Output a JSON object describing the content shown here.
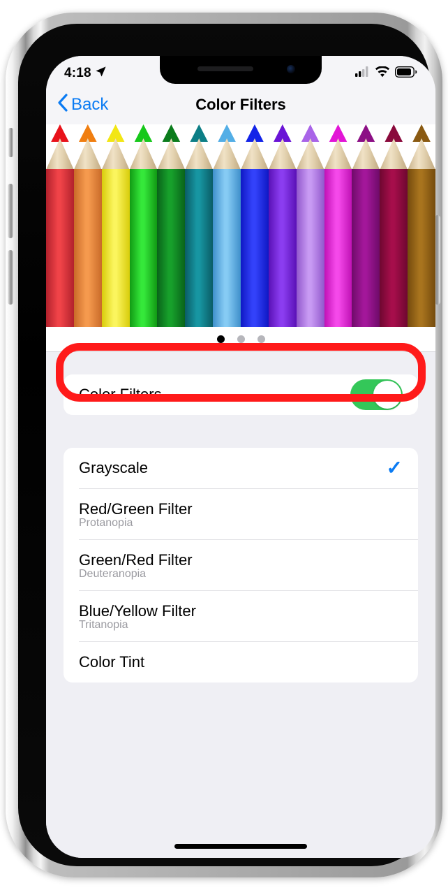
{
  "device": {
    "name": "iphone-x",
    "frame_color": "#c9c9c9"
  },
  "status_bar": {
    "time": "4:18",
    "location_icon": "location-arrow-icon",
    "cellular_icon": "cellular-signal-icon",
    "cellular_bars": 2,
    "wifi_icon": "wifi-icon",
    "battery_icon": "battery-icon",
    "battery_level": 78
  },
  "nav_bar": {
    "back_label": "Back",
    "back_icon": "chevron-left-icon",
    "title": "Color Filters",
    "accent_color": "#0A7BF3"
  },
  "hero": {
    "name": "color-pencils-preview",
    "pencils": [
      {
        "tip": "#E8121A",
        "body_dark": "#B2212C",
        "body_light": "#F04348"
      },
      {
        "tip": "#F07E10",
        "body_dark": "#C96A28",
        "body_light": "#F59A4E"
      },
      {
        "tip": "#F2E615",
        "body_dark": "#D8CC0B",
        "body_light": "#FBF55E"
      },
      {
        "tip": "#17C81B",
        "body_dark": "#119A14",
        "body_light": "#35E83A"
      },
      {
        "tip": "#0B7C1C",
        "body_dark": "#09631A",
        "body_light": "#17A02B"
      },
      {
        "tip": "#0C7E86",
        "body_dark": "#0A5C66",
        "body_light": "#1796A2"
      },
      {
        "tip": "#53AEE6",
        "body_dark": "#3E8FCB",
        "body_light": "#86CBF4"
      },
      {
        "tip": "#1324E8",
        "body_dark": "#0F18C4",
        "body_light": "#3342FA"
      },
      {
        "tip": "#6A14D6",
        "body_dark": "#5A11B6",
        "body_light": "#8B3DF0"
      },
      {
        "tip": "#A964E8",
        "body_dark": "#9157CC",
        "body_light": "#C89AF3"
      },
      {
        "tip": "#E215D6",
        "body_dark": "#C012B5",
        "body_light": "#F549EA"
      },
      {
        "tip": "#8C0F85",
        "body_dark": "#6E0B69",
        "body_light": "#A3179A"
      },
      {
        "tip": "#8A0A3C",
        "body_dark": "#6E0730",
        "body_light": "#A60E4B"
      },
      {
        "tip": "#8A5A12",
        "body_dark": "#744A0D",
        "body_light": "#A8741E"
      }
    ]
  },
  "page_dots": {
    "name": "page-indicator",
    "count": 3,
    "active_index": 0
  },
  "toggle_section": {
    "label": "Color Filters",
    "enabled": true,
    "on_color": "#34C759"
  },
  "filters_section": {
    "rows": [
      {
        "title": "Grayscale",
        "subtitle": "",
        "selected": true
      },
      {
        "title": "Red/Green Filter",
        "subtitle": "Protanopia",
        "selected": false
      },
      {
        "title": "Green/Red Filter",
        "subtitle": "Deuteranopia",
        "selected": false
      },
      {
        "title": "Blue/Yellow Filter",
        "subtitle": "Tritanopia",
        "selected": false
      },
      {
        "title": "Color Tint",
        "subtitle": "",
        "selected": false
      }
    ],
    "checkmark_icon": "checkmark-icon",
    "checkmark_glyph": "✓"
  },
  "annotation": {
    "name": "red-highlight-box",
    "target": "Grayscale",
    "color": "#FF1A1A"
  }
}
